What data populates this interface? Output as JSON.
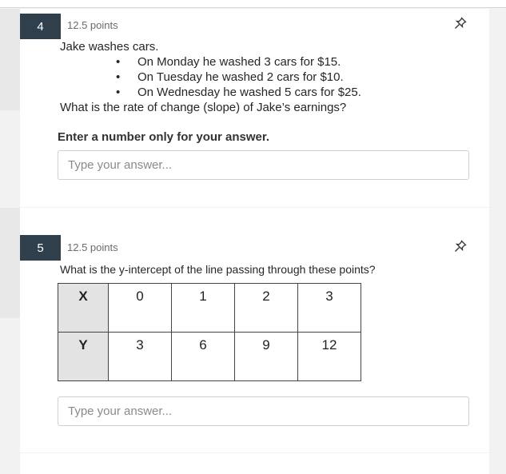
{
  "questions": [
    {
      "number": "4",
      "points": "12.5 points",
      "prompt": "Jake washes cars.",
      "bullets": [
        "On Monday he washed 3 cars for $15.",
        "On Tuesday he washed 2 cars for $10.",
        "On Wednesday he washed 5 cars for $25."
      ],
      "question": "What is the rate of change (slope) of Jake’s earnings?",
      "instruction": "Enter a number only for your answer.",
      "answer_value": "",
      "answer_placeholder": "Type your answer..."
    },
    {
      "number": "5",
      "points": "12.5 points",
      "question": "What is the y-intercept of the line passing through these points?",
      "table": {
        "rows": [
          {
            "label": "X",
            "values": [
              "0",
              "1",
              "2",
              "3"
            ]
          },
          {
            "label": "Y",
            "values": [
              "3",
              "6",
              "9",
              "12"
            ]
          }
        ]
      },
      "answer_value": "",
      "answer_placeholder": "Type your answer..."
    }
  ],
  "icons": {
    "pin": "pin-icon"
  },
  "colors": {
    "question_badge": "#2f3f4c",
    "points_text": "#6b6b6b"
  }
}
